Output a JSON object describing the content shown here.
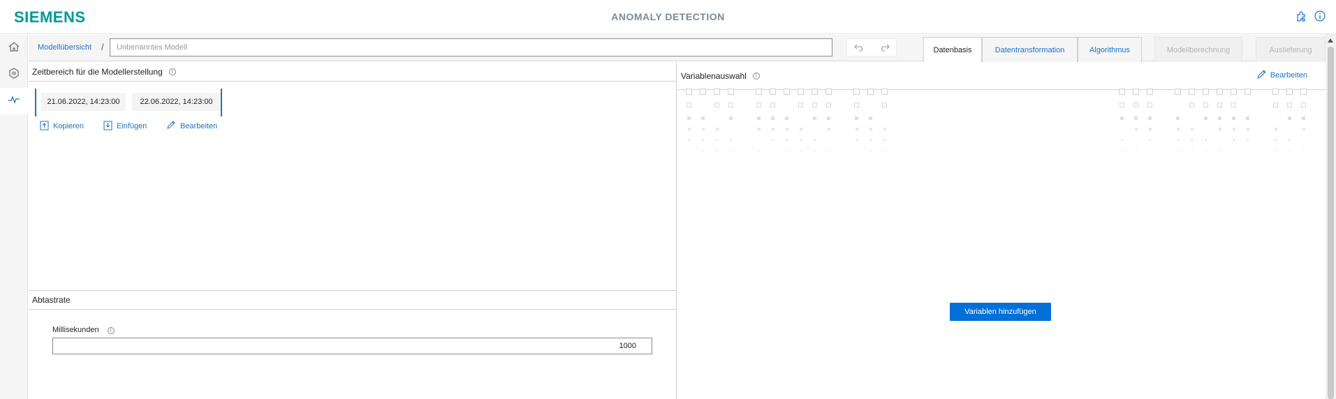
{
  "header": {
    "logo": "SIEMENS",
    "title": "ANOMALY DETECTION",
    "icons": [
      "puzzle-icon",
      "info-icon"
    ]
  },
  "sidebar": {
    "items": [
      {
        "icon": "home-icon"
      },
      {
        "icon": "sensor-icon"
      },
      {
        "icon": "pulse-icon",
        "active": true
      }
    ]
  },
  "toolbar": {
    "breadcrumb_root": "Modellübersicht",
    "breadcrumb_separator": "/",
    "model_name_value": "",
    "model_name_placeholder": "Unbenanntes Modell",
    "tabs": [
      {
        "label": "Datenbasis",
        "state": "active"
      },
      {
        "label": "Datentransformation",
        "state": "enabled"
      },
      {
        "label": "Algorithmus",
        "state": "enabled"
      },
      {
        "label": "Modellberechnung",
        "state": "disabled"
      },
      {
        "label": "Auslieferung",
        "state": "disabled"
      }
    ]
  },
  "time_range": {
    "title": "Zeitbereich für die Modellerstellung",
    "start": "21.06.2022, 14:23:00",
    "end": "22.06.2022, 14:23:00",
    "actions": {
      "copy": "Kopieren",
      "paste": "Einfügen",
      "edit": "Bearbeiten"
    }
  },
  "sampling": {
    "title": "Abtastrate",
    "label": "Millisekunden",
    "value": "1000"
  },
  "variables": {
    "title": "Variablenauswahl",
    "edit": "Bearbeiten",
    "add_button": "Variablen hinzufügen"
  },
  "colors": {
    "brand": "#009999",
    "accent": "#1a73c9",
    "primary_button": "#0070d8"
  }
}
